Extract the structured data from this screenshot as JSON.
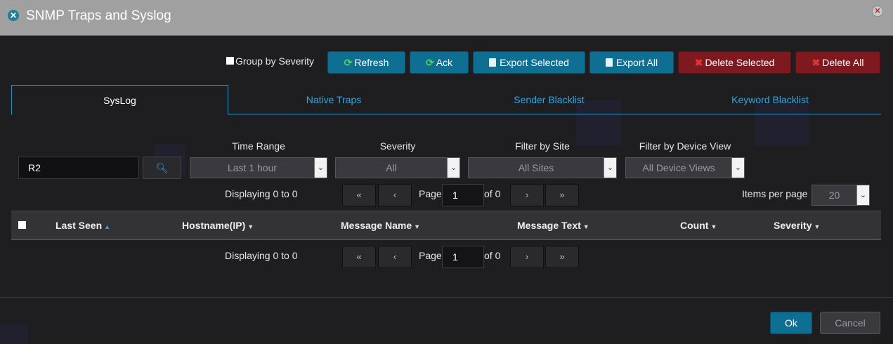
{
  "window": {
    "title": "SNMP Traps and Syslog"
  },
  "toolbar": {
    "group_by_severity": "Group by Severity",
    "refresh": "Refresh",
    "ack": "Ack",
    "export_selected": "Export Selected",
    "export_all": "Export All",
    "delete_selected": "Delete Selected",
    "delete_all": "Delete All"
  },
  "tabs": [
    {
      "label": "SysLog",
      "active": true
    },
    {
      "label": "Native Traps",
      "active": false
    },
    {
      "label": "Sender Blacklist",
      "active": false
    },
    {
      "label": "Keyword Blacklist",
      "active": false
    }
  ],
  "filters": {
    "search_value": "R2",
    "time_range_label": "Time Range",
    "time_range_value": "Last 1 hour",
    "severity_label": "Severity",
    "severity_value": "All",
    "site_label": "Filter by Site",
    "site_value": "All Sites",
    "device_view_label": "Filter by Device View",
    "device_view_value": "All Device Views"
  },
  "pager": {
    "displaying": "Displaying 0 to 0",
    "page_label": "Page",
    "page_value": "1",
    "of_label": "of 0",
    "items_per_page_label": "Items per page",
    "items_per_page_value": "20"
  },
  "grid": {
    "columns": [
      "Last Seen",
      "Hostname(IP)",
      "Message Name",
      "Message Text",
      "Count",
      "Severity"
    ]
  },
  "footer": {
    "ok": "Ok",
    "cancel": "Cancel"
  },
  "colors": {
    "accent": "#0f6f93",
    "danger": "#7e1a1f",
    "link": "#33a6df"
  }
}
